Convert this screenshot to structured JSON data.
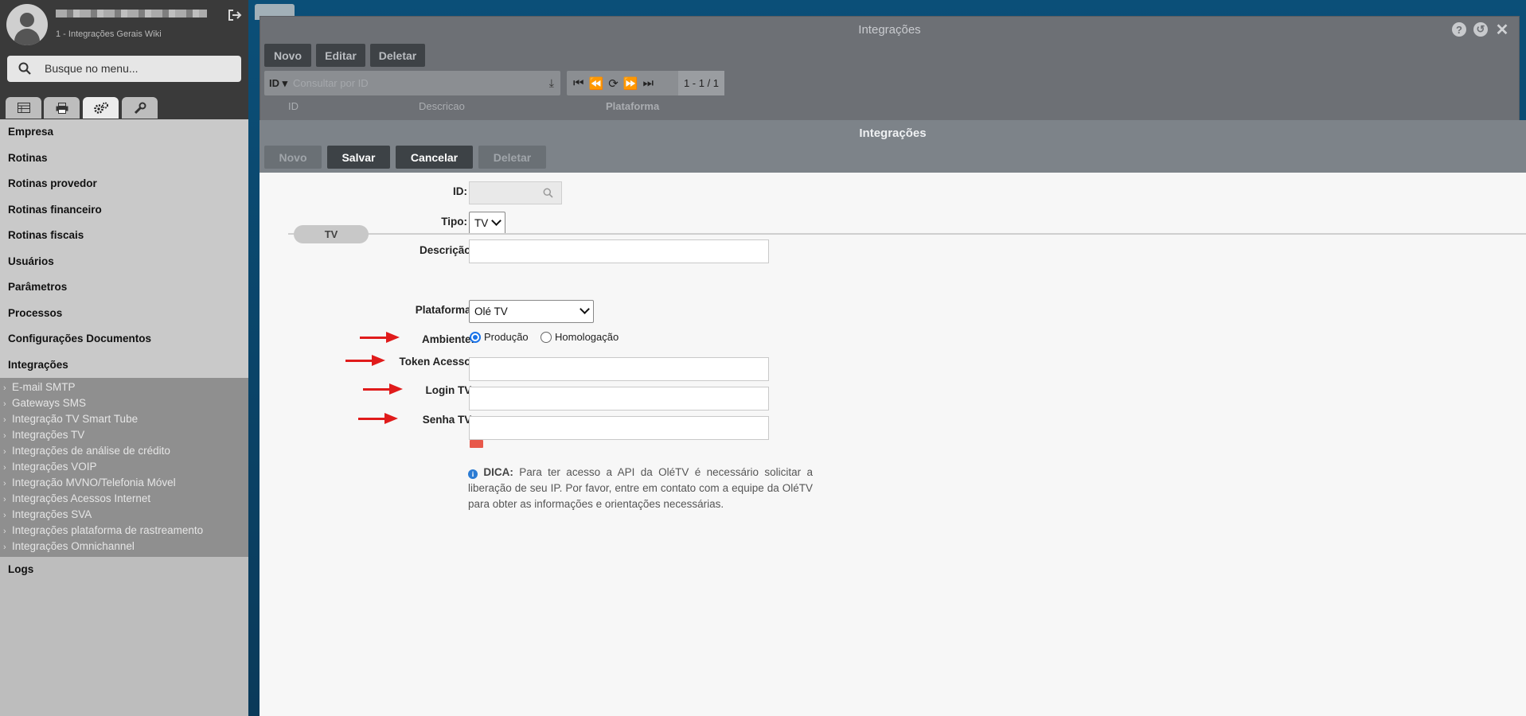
{
  "sidebar": {
    "user_subtitle": "1 - Integrações Gerais Wiki",
    "search_placeholder": "Busque no menu...",
    "tabs": [
      "table-icon",
      "print-icon",
      "gears-icon",
      "wrench-icon"
    ],
    "menu": [
      "Empresa",
      "Rotinas",
      "Rotinas provedor",
      "Rotinas financeiro",
      "Rotinas fiscais",
      "Usuários",
      "Parâmetros",
      "Processos",
      "Configurações Documentos",
      "Integrações"
    ],
    "submenu": [
      "E-mail SMTP",
      "Gateways SMS",
      "Integração TV Smart Tube",
      "Integrações TV",
      "Integrações de análise de crédito",
      "Integrações VOIP",
      "Integração MVNO/Telefonia Móvel",
      "Integrações Acessos Internet",
      "Integrações SVA",
      "Integrações plataforma de rastreamento",
      "Integrações Omnichannel"
    ],
    "last_item": "Logs"
  },
  "bg_window": {
    "title": "Integrações",
    "buttons": {
      "novo": "Novo",
      "editar": "Editar",
      "deletar": "Deletar"
    },
    "search": {
      "field": "ID",
      "placeholder": "Consultar por ID"
    },
    "pager": "1 - 1 / 1",
    "columns": [
      "ID",
      "Descricao",
      "Plataforma"
    ]
  },
  "modal": {
    "title": "Integrações",
    "buttons": {
      "novo": "Novo",
      "salvar": "Salvar",
      "cancelar": "Cancelar",
      "deletar": "Deletar"
    },
    "fields": {
      "id_label": "ID:",
      "tipo_label": "Tipo:",
      "tipo_value": "TV",
      "descricao_label": "Descrição:",
      "section": "TV",
      "plataforma_label": "Plataforma:",
      "plataforma_value": "Olé TV",
      "ambiente_label": "Ambiente:",
      "ambiente_options": [
        "Produção",
        "Homologação"
      ],
      "ambiente_selected": "Produção",
      "token_label": "Token Acesso:",
      "login_label": "Login TV:",
      "senha_label": "Senha TV:"
    },
    "tip": {
      "prefix": "DICA:",
      "text": "Para ter acesso a API da OléTV é necessário solicitar a liberação de seu IP. Por favor, entre em contato com a equipe da OléTV para obter as informações e orientações necessárias."
    }
  },
  "colors": {
    "arrow": "#e01b1b",
    "accent": "#1a73e8"
  }
}
